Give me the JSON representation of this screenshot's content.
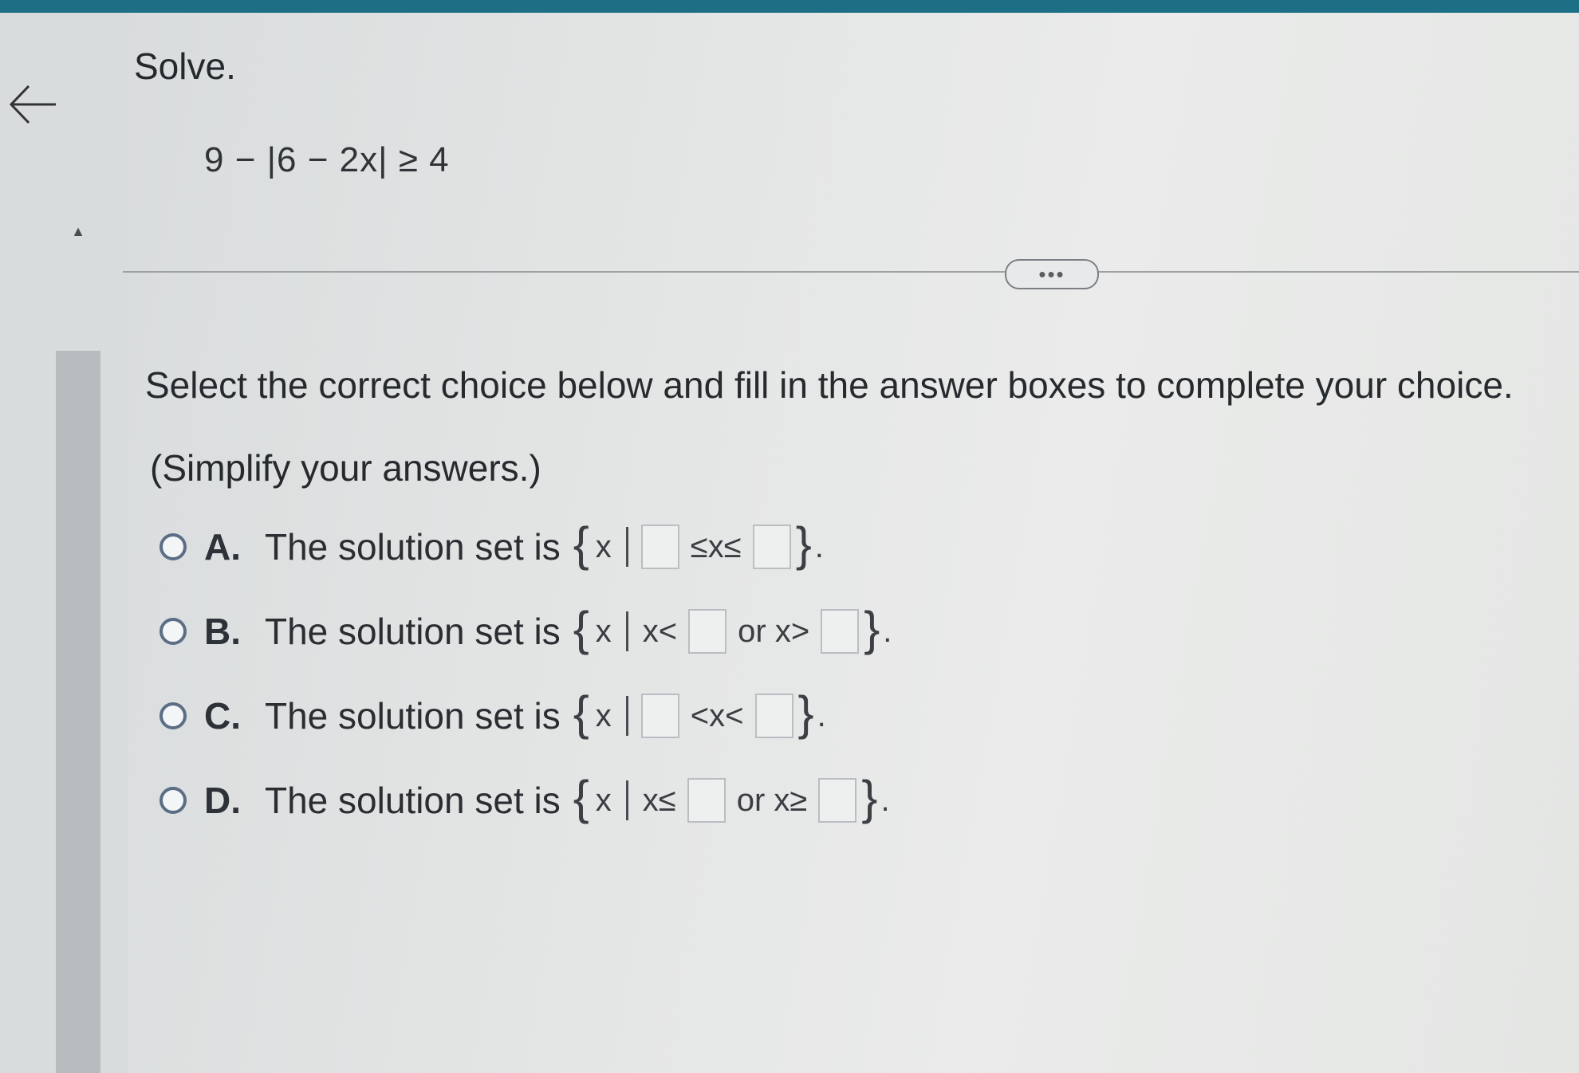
{
  "header": {
    "solve_label": "Solve.",
    "equation": "9 − |6 − 2x| ≥ 4",
    "more_label": "•••"
  },
  "instructions": "Select the correct choice below and fill in the answer boxes to complete your choice.",
  "simplify": "(Simplify your answers.)",
  "choices": [
    {
      "letter": "A.",
      "text": "The solution set is",
      "set": "x",
      "op1": "≤x≤",
      "op2": ""
    },
    {
      "letter": "B.",
      "text": "The solution set is",
      "set": "x",
      "op1": "x<",
      "op2": "or x>"
    },
    {
      "letter": "C.",
      "text": "The solution set is",
      "set": "x",
      "op1": "<x<",
      "op2": ""
    },
    {
      "letter": "D.",
      "text": "The solution set is",
      "set": "x",
      "op1": "x≤",
      "op2": "or x≥"
    }
  ],
  "colors": {
    "top_bar": "#1d6f86",
    "radio_border": "#5b6e86"
  },
  "icons": {
    "back": "left-arrow-icon",
    "scroll_up": "triangle-up-icon"
  }
}
